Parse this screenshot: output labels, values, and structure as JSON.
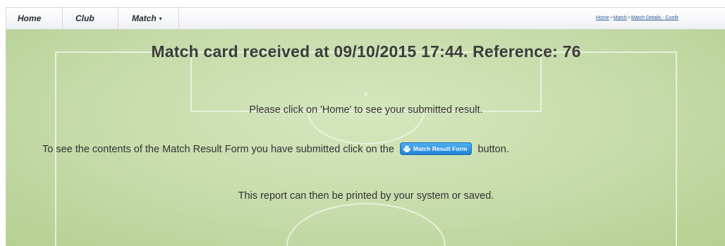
{
  "nav": {
    "home": "Home",
    "club": "Club",
    "match": "Match",
    "match_caret": "▾"
  },
  "breadcrumb": {
    "items": [
      "Home",
      "Match",
      "Match Details - Confir"
    ],
    "separator": ">"
  },
  "main": {
    "title": "Match card received at 09/10/2015 17:44. Reference: 76",
    "line1": "Please click on 'Home' to see your submitted result.",
    "line2_before": "To see the contents of the Match Result Form you have submitted click on the",
    "button_label": "Match Result Form",
    "button_icon": "printer-icon",
    "line2_after": "button.",
    "line3": "This report can then be printed by your system or saved."
  },
  "colors": {
    "pitch": "#c6dbaa",
    "button": "#2a8ce0"
  }
}
